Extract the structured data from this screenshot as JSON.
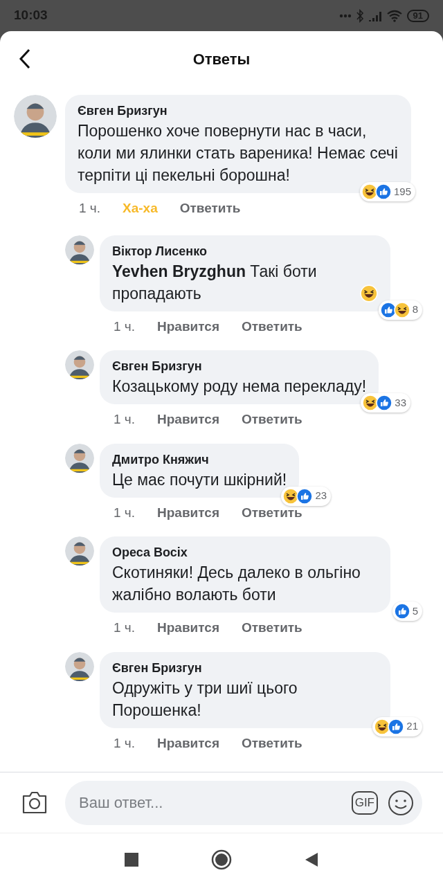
{
  "status_bar": {
    "time": "10:03",
    "battery": "91"
  },
  "header": {
    "title": "Ответы"
  },
  "comments": [
    {
      "author": "Євген Бризгун",
      "text": "Порошенко хоче повернути нас в часи, коли ми ялинки стать вареника! Немає сечі терпіти ці пекельні борошна!",
      "emoji_after": false,
      "reply": false,
      "time": "1 ч.",
      "like_label": "Ха-ха",
      "reacted": true,
      "reply_label": "Ответить",
      "reactions": [
        {
          "kind": "haha"
        },
        {
          "kind": "like"
        }
      ],
      "count": "195"
    },
    {
      "author": "Віктор Лисенко",
      "text": "**Yevhen Bryzghun** Такі боти пропадають",
      "emoji_after": true,
      "reply": true,
      "time": "1 ч.",
      "like_label": "Нравится",
      "reacted": false,
      "reply_label": "Ответить",
      "reactions": [
        {
          "kind": "like"
        },
        {
          "kind": "haha"
        }
      ],
      "count": "8"
    },
    {
      "author": "Євген Бризгун",
      "text": "Козацькому роду нема перекладу!",
      "emoji_after": false,
      "reply": true,
      "time": "1 ч.",
      "like_label": "Нравится",
      "reacted": false,
      "reply_label": "Ответить",
      "reactions": [
        {
          "kind": "haha"
        },
        {
          "kind": "like"
        }
      ],
      "count": "33"
    },
    {
      "author": "Дмитро Княжич",
      "text": "Це має почути шкірний!",
      "emoji_after": false,
      "reply": true,
      "time": "1 ч.",
      "like_label": "Нравится",
      "reacted": false,
      "reply_label": "Ответить",
      "reactions": [
        {
          "kind": "haha"
        },
        {
          "kind": "like"
        }
      ],
      "count": "23"
    },
    {
      "author": "Ореса Восіх",
      "text": "Скотиняки! Десь далеко в ольгіно жалібно волають боти",
      "emoji_after": false,
      "reply": true,
      "time": "1 ч.",
      "like_label": "Нравится",
      "reacted": false,
      "reply_label": "Ответить",
      "reactions": [
        {
          "kind": "like"
        }
      ],
      "count": "5"
    },
    {
      "author": "Євген Бризгун",
      "text": "Одружіть у три шиї цього Порошенка!",
      "emoji_after": false,
      "reply": true,
      "time": "1 ч.",
      "like_label": "Нравится",
      "reacted": false,
      "reply_label": "Ответить",
      "reactions": [
        {
          "kind": "haha"
        },
        {
          "kind": "like"
        }
      ],
      "count": "21"
    }
  ],
  "composer": {
    "placeholder": "Ваш ответ...",
    "gif_label": "GIF"
  }
}
